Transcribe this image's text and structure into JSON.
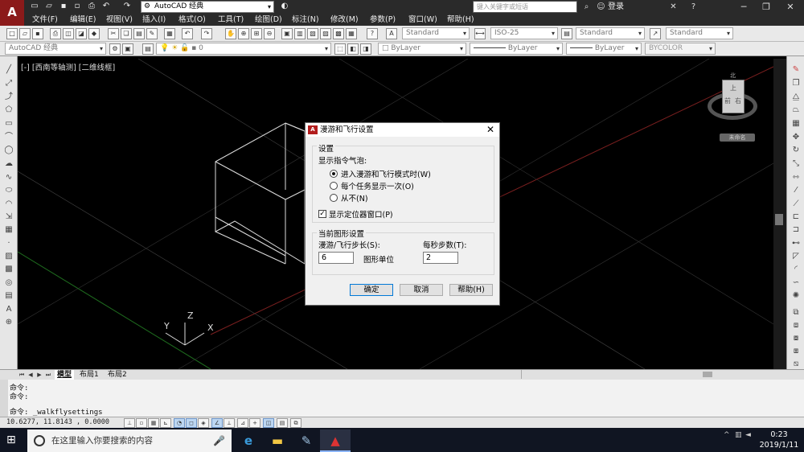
{
  "app": {
    "logo": "A",
    "workspace": "AutoCAD 经典",
    "search_placeholder": "键入关键字或短语",
    "login": "登录"
  },
  "menu": [
    "文件(F)",
    "编辑(E)",
    "视图(V)",
    "插入(I)",
    "格式(O)",
    "工具(T)",
    "绘图(D)",
    "标注(N)",
    "修改(M)",
    "参数(P)",
    "窗口(W)",
    "帮助(H)"
  ],
  "styles": {
    "text_style": "Standard",
    "dim_style": "ISO-25",
    "table_style": "Standard",
    "mleader_style": "Standard"
  },
  "properties": {
    "workspace2": "AutoCAD 经典",
    "layer": "0",
    "color": "ByLayer",
    "linetype": "ByLayer",
    "lineweight": "ByLayer",
    "plotstyle": "BYCOLOR"
  },
  "viewport": {
    "label": "[-] [西南等轴测] [二维线框]",
    "viewcube_top": "上",
    "viewcube_front": "前",
    "viewcube_right": "右",
    "viewcube_north": "北",
    "ucs_label": "未命名",
    "axis_x": "X",
    "axis_y": "Y",
    "axis_z": "Z"
  },
  "tabs": [
    "模型",
    "布局1",
    "布局2"
  ],
  "command": {
    "line1": "命令:",
    "line2": "命令:",
    "line3": "命令: _walkflysettings"
  },
  "status": {
    "coords": "10.6277, 11.8143 , 0.0000"
  },
  "dialog": {
    "title": "漫游和飞行设置",
    "settings_label": "设置",
    "show_bubble_label": "显示指令气泡:",
    "radio1": "进入漫游和飞行模式时(W)",
    "radio2": "每个任务显示一次(O)",
    "radio3": "从不(N)",
    "radio_selected": 1,
    "show_locator": "显示定位器窗口(P)",
    "show_locator_checked": true,
    "current_drawing_label": "当前图形设置",
    "step_size_label": "漫游/飞行步长(S):",
    "step_size_value": "6",
    "drawing_units": "图形单位",
    "steps_per_sec_label": "每秒步数(T):",
    "steps_per_sec_value": "2",
    "ok": "确定",
    "cancel": "取消",
    "help": "帮助(H)"
  },
  "taskbar": {
    "search_placeholder": "在这里输入你要搜索的内容",
    "time": "0:23",
    "date": "2019/1/11"
  }
}
